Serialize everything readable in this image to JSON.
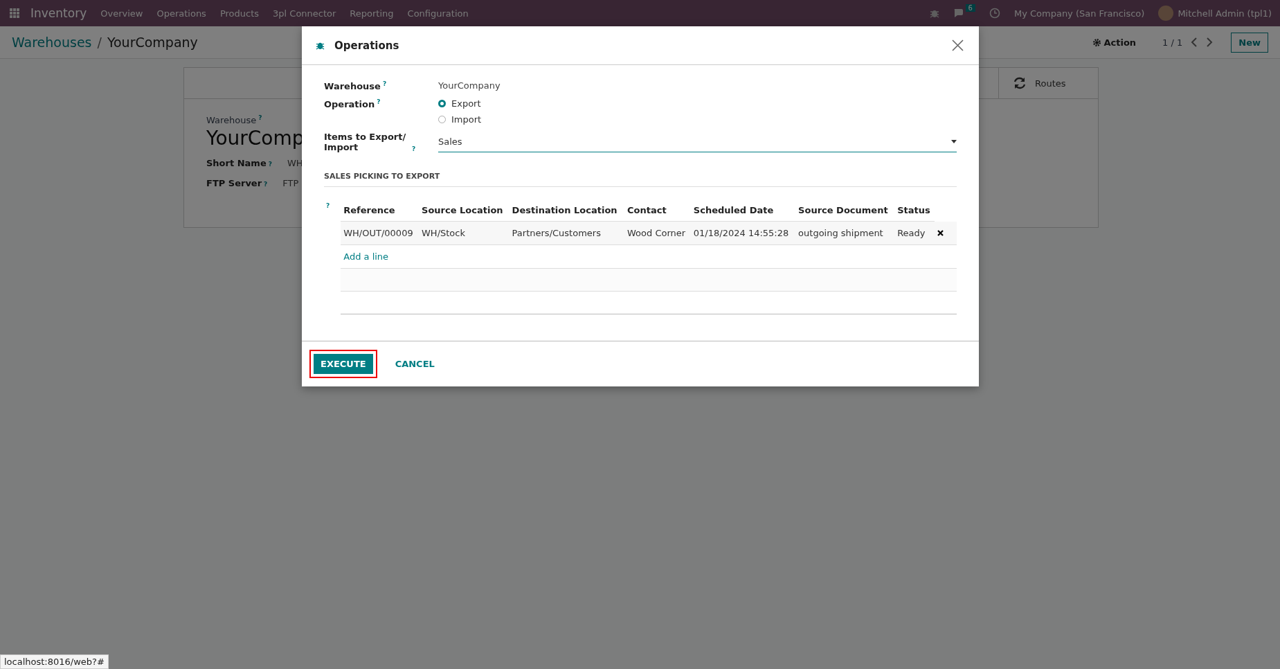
{
  "navbar": {
    "app_name": "Inventory",
    "menu": [
      "Overview",
      "Operations",
      "Products",
      "3pl Connector",
      "Reporting",
      "Configuration"
    ],
    "messages_count": "6",
    "company": "My Company (San Francisco)",
    "user": "Mitchell Admin (tpl1)"
  },
  "help_mark": "?",
  "control_panel": {
    "breadcrumb_separator": "/",
    "breadcrumb": [
      {
        "label": "Warehouses",
        "link": true
      },
      {
        "label": "YourCompany",
        "link": false
      }
    ],
    "action": "Action",
    "pager": "1 / 1",
    "new_button": "New"
  },
  "background_form": {
    "button_box": [
      "Routes"
    ],
    "title_label": "Warehouse",
    "title": "YourComp",
    "fields": [
      {
        "label": "Short Name",
        "value": "WH"
      },
      {
        "label": "FTP Server",
        "value": "FTP"
      }
    ]
  },
  "dialog": {
    "title": "Operations",
    "warehouse": {
      "label": "Warehouse",
      "value": "YourCompany"
    },
    "operation": {
      "label": "Operation",
      "options": [
        {
          "label": "Export",
          "selected": true
        },
        {
          "label": "Import",
          "selected": false
        }
      ]
    },
    "items": {
      "label": "Items to Export/ Import",
      "value": "Sales"
    },
    "section_title": "SALES PICKING TO EXPORT",
    "table": {
      "columns": [
        "Reference",
        "Source Location",
        "Destination Location",
        "Contact",
        "Scheduled Date",
        "Source Document",
        "Status"
      ],
      "rows": [
        [
          "WH/OUT/00009",
          "WH/Stock",
          "Partners/Customers",
          "Wood Corner",
          "01/18/2024 14:55:28",
          "outgoing shipment",
          "Ready"
        ]
      ],
      "add_line": "Add a line"
    },
    "buttons": [
      {
        "label": "EXECUTE",
        "kind": "primary",
        "highlighted": true
      },
      {
        "label": "CANCEL",
        "kind": "link",
        "highlighted": false
      }
    ]
  },
  "status_url": "localhost:8016/web?#"
}
